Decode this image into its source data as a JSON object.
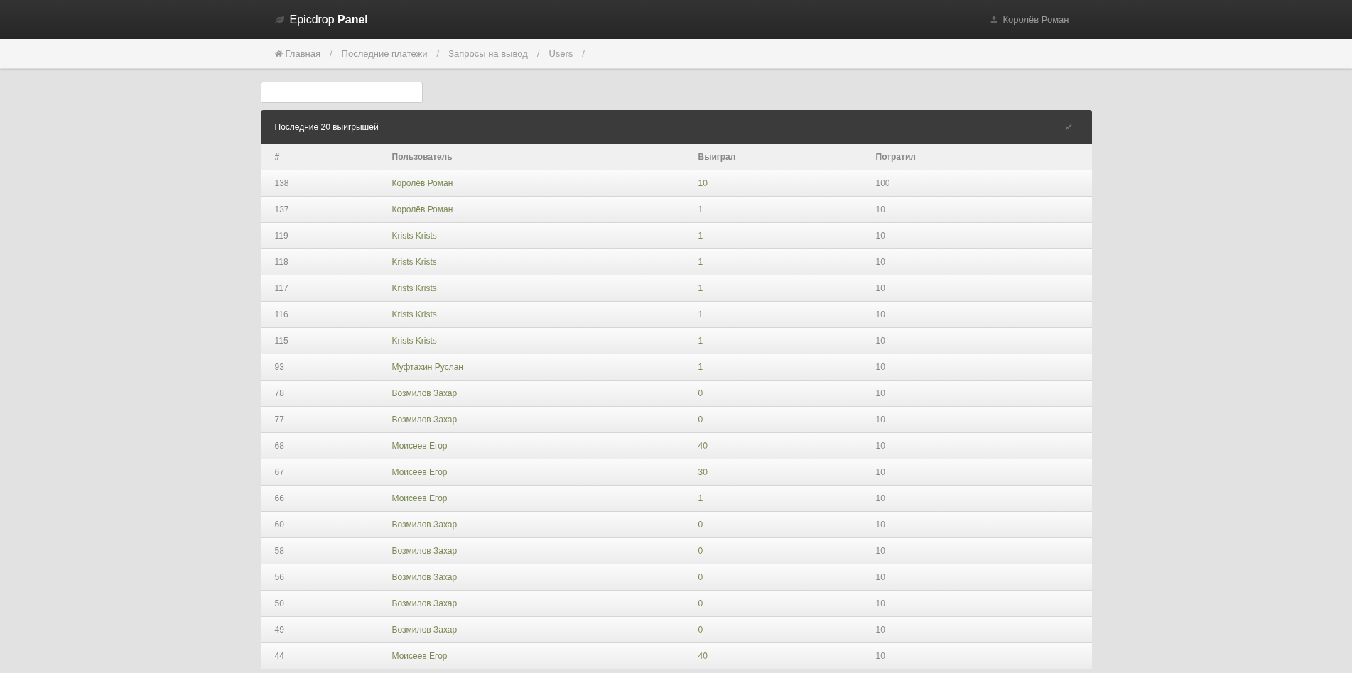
{
  "navbar": {
    "brand": "Epicdrop",
    "brand_bold": "Panel",
    "user": "Королёв Роман"
  },
  "breadcrumbs": [
    {
      "label": "Главная",
      "kind": "home",
      "separator": "/"
    },
    {
      "label": "Последние платежи",
      "kind": "link",
      "separator": "/"
    },
    {
      "label": "Запросы на вывод",
      "kind": "link",
      "separator": "/"
    },
    {
      "label": "Users",
      "kind": "link",
      "separator": "/"
    }
  ],
  "panel": {
    "title": "Последние 20 выигрышей",
    "table": {
      "columns": [
        "#",
        "Пользователь",
        "Выиграл",
        "Потратил"
      ],
      "rows": [
        [
          "138",
          "Королёв Роман",
          "10",
          "100"
        ],
        [
          "137",
          "Королёв Роман",
          "1",
          "10"
        ],
        [
          "119",
          "Krists Krists",
          "1",
          "10"
        ],
        [
          "118",
          "Krists Krists",
          "1",
          "10"
        ],
        [
          "117",
          "Krists Krists",
          "1",
          "10"
        ],
        [
          "116",
          "Krists Krists",
          "1",
          "10"
        ],
        [
          "115",
          "Krists Krists",
          "1",
          "10"
        ],
        [
          "93",
          "Муфтахин Руслан",
          "1",
          "10"
        ],
        [
          "78",
          "Возмилов Захар",
          "0",
          "10"
        ],
        [
          "77",
          "Возмилов Захар",
          "0",
          "10"
        ],
        [
          "68",
          "Моисеев Егор",
          "40",
          "10"
        ],
        [
          "67",
          "Моисеев Егор",
          "30",
          "10"
        ],
        [
          "66",
          "Моисеев Егор",
          "1",
          "10"
        ],
        [
          "60",
          "Возмилов Захар",
          "0",
          "10"
        ],
        [
          "58",
          "Возмилов Захар",
          "0",
          "10"
        ],
        [
          "56",
          "Возмилов Захар",
          "0",
          "10"
        ],
        [
          "50",
          "Возмилов Захар",
          "0",
          "10"
        ],
        [
          "49",
          "Возмилов Захар",
          "0",
          "10"
        ],
        [
          "44",
          "Моисеев Егор",
          "40",
          "10"
        ]
      ]
    }
  }
}
